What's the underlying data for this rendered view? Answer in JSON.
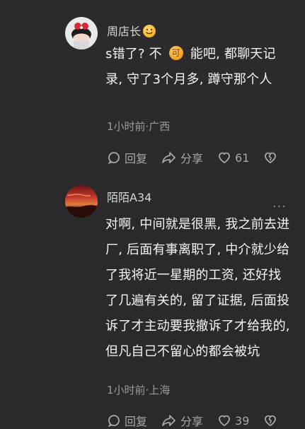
{
  "comments": [
    {
      "username": "周店长",
      "text_before_icon": "s错了? 不 ",
      "inline_icon_label": "可",
      "text_after_icon": " 能吧, 都聊天记录, 守了3个月多, 蹲守那个人",
      "meta": "1小时前·广西",
      "actions": {
        "reply_label": "回复",
        "share_label": "分享",
        "like_count": "61"
      }
    },
    {
      "username": "陌陌A34",
      "text": "对啊, 中间就是很黑, 我之前去进厂, 后面有事离职了, 中介就少给了我将近一星期的工资, 还好找了几遍有关的, 留了证据, 后面投诉了才主动要我撤诉了才给我的, 但凡自己不留心的都会被坑",
      "meta": "1小时前·上海",
      "more_label": "···",
      "actions": {
        "reply_label": "回复",
        "share_label": "分享",
        "like_count": "39"
      }
    }
  ],
  "colors": {
    "background": "#2b2b2d",
    "primary_text": "#f5f5f5",
    "secondary_text": "#9a9a9a",
    "username_text": "#d6d6d6",
    "icon_gray": "#a8a8a8"
  },
  "icons": {
    "reply": "chat-bubble-icon",
    "share": "share-arrow-icon",
    "like": "heart-outline-icon",
    "dislike": "broken-heart-icon",
    "more": "more-dots-icon",
    "emoji": "smile-emoji-icon"
  }
}
